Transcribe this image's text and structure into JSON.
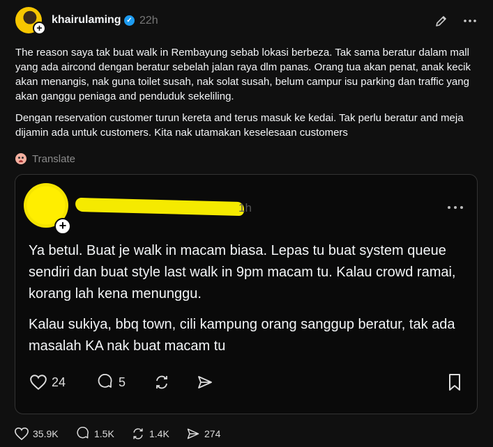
{
  "post": {
    "username": "khairulaming",
    "time": "22h",
    "paragraphs": [
      "The reason saya tak buat walk in Rembayung sebab lokasi berbeza. Tak sama beratur dalam mall yang ada aircond dengan beratur sebelah jalan raya dlm panas. Orang tua akan penat, anak kecik akan menangis, nak guna toilet susah, nak solat susah, belum campur isu parking dan traffic yang akan ganggu peniaga and penduduk sekeliling.",
      "Dengan reservation customer turun kereta and terus masuk ke kedai. Tak perlu beratur and meja dijamin ada untuk customers. Kita nak utamakan keselesaan customers"
    ],
    "translate_label": "Translate",
    "stats": {
      "likes": "35.9K",
      "replies": "1.5K",
      "reposts": "1.4K",
      "shares": "274"
    }
  },
  "quote": {
    "time": "1h",
    "paragraphs": [
      "Ya betul. Buat je walk in macam biasa. Lepas tu buat system queue sendiri dan buat style last walk in 9pm macam tu. Kalau crowd ramai, korang lah kena menunggu.",
      "Kalau sukiya, bbq town, cili kampung orang sanggup beratur, tak ada masalah KA nak buat macam tu"
    ],
    "stats": {
      "likes": "24",
      "replies": "5"
    }
  },
  "colors": {
    "background": "#101010",
    "verified": "#1d9bf0",
    "redaction": "#f5ea00"
  }
}
